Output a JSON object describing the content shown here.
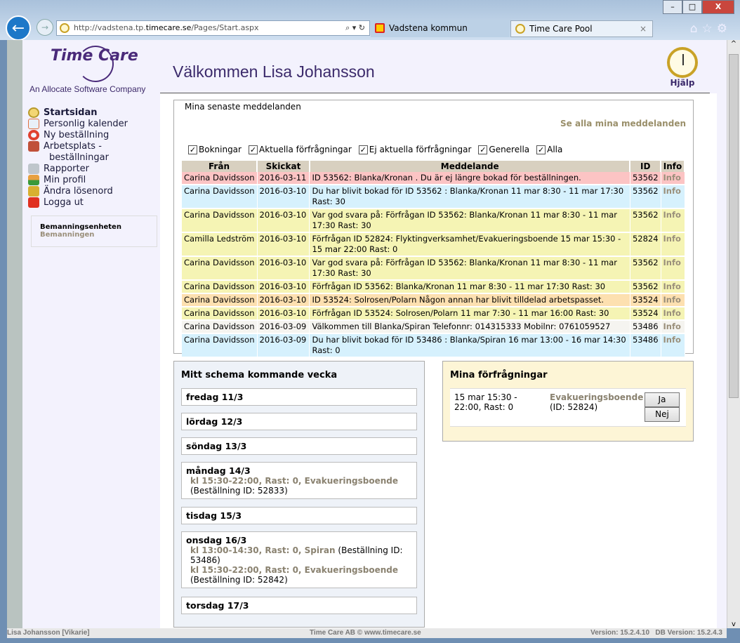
{
  "browser": {
    "url_prefix": "http://vadstena.tp.",
    "url_domain": "timecare.se",
    "url_path": "/Pages/Start.aspx",
    "tabs": [
      {
        "label": "Vadstena kommun"
      },
      {
        "label": "Time Care Pool"
      }
    ],
    "close": "×"
  },
  "header": {
    "logo": "Time Care",
    "tagline": "An Allocate Software Company",
    "welcome": "Välkommen Lisa Johansson",
    "help": "Hjälp"
  },
  "nav": {
    "items": [
      {
        "label": "Startsidan",
        "icon": "clock-icon"
      },
      {
        "label": "Personlig kalender",
        "icon": "calendar-icon"
      },
      {
        "label": "Ny beställning",
        "icon": "lifebuoy-icon"
      },
      {
        "label": "Arbetsplats -",
        "label2": "beställningar",
        "icon": "workplace-icon"
      },
      {
        "label": "Rapporter",
        "icon": "printer-icon"
      },
      {
        "label": "Min profil",
        "icon": "user-icon"
      },
      {
        "label": "Ändra lösenord",
        "icon": "lock-icon"
      },
      {
        "label": "Logga ut",
        "icon": "power-icon"
      }
    ],
    "unit": {
      "title": "Bemanningsenheten",
      "sub": "Bemanningen"
    }
  },
  "messages": {
    "title": "Mina senaste meddelanden",
    "see_all": "Se alla mina meddelanden",
    "filters": [
      "Bokningar",
      "Aktuella förfrågningar",
      "Ej aktuella förfrågningar",
      "Generella",
      "Alla"
    ],
    "columns": [
      "Från",
      "Skickat",
      "Meddelande",
      "ID",
      "Info"
    ],
    "rows": [
      {
        "from": "Carina Davidsson",
        "sent": "2016-03-11",
        "msg": "ID 53562: Blanka/Kronan . Du är ej längre bokad för beställningen.",
        "id": "53562",
        "info": "Info",
        "color": "#fcc4c4"
      },
      {
        "from": "Carina Davidsson",
        "sent": "2016-03-10",
        "msg": "Du har blivit bokad för ID 53562 : Blanka/Kronan 11 mar 8:30 - 11 mar 17:30 Rast: 30",
        "id": "53562",
        "info": "Info",
        "color": "#d6f1fd"
      },
      {
        "from": "Carina Davidsson",
        "sent": "2016-03-10",
        "msg": "Var god svara på: Förfrågan ID 53562: Blanka/Kronan 11 mar 8:30 - 11 mar 17:30 Rast: 30",
        "id": "53562",
        "info": "Info",
        "color": "#f5f4b4"
      },
      {
        "from": "Camilla Ledström",
        "sent": "2016-03-10",
        "msg": "Förfrågan ID 52824: Flyktingverksamhet/Evakueringsboende 15 mar 15:30 - 15 mar 22:00 Rast: 0",
        "id": "52824",
        "info": "Info",
        "color": "#f5f4b4"
      },
      {
        "from": "Carina Davidsson",
        "sent": "2016-03-10",
        "msg": "Var god svara på: Förfrågan ID 53562: Blanka/Kronan 11 mar 8:30 - 11 mar 17:30 Rast: 30",
        "id": "53562",
        "info": "Info",
        "color": "#f5f4b4"
      },
      {
        "from": "Carina Davidsson",
        "sent": "2016-03-10",
        "msg": "Förfrågan ID 53562: Blanka/Kronan 11 mar 8:30 - 11 mar 17:30 Rast: 30",
        "id": "53562",
        "info": "Info",
        "color": "#f5f4b4"
      },
      {
        "from": "Carina Davidsson",
        "sent": "2016-03-10",
        "msg": "ID 53524: Solrosen/Polarn Någon annan har blivit tilldelad arbetspasset.",
        "id": "53524",
        "info": "Info",
        "color": "#fde0b0"
      },
      {
        "from": "Carina Davidsson",
        "sent": "2016-03-10",
        "msg": "Förfrågan ID 53524: Solrosen/Polarn 11 mar 7:30 - 11 mar 16:00 Rast: 30",
        "id": "53524",
        "info": "Info",
        "color": "#f5f4b4"
      },
      {
        "from": "Carina Davidsson",
        "sent": "2016-03-09",
        "msg": "Välkommen till Blanka/Spiran Telefonnr: 014315333 Mobilnr: 0761059527",
        "id": "53486",
        "info": "Info",
        "color": "#f5f4f0"
      },
      {
        "from": "Carina Davidsson",
        "sent": "2016-03-09",
        "msg": "Du har blivit bokad för ID 53486 : Blanka/Spiran 16 mar 13:00 - 16 mar 14:30 Rast: 0",
        "id": "53486",
        "info": "Info",
        "color": "#d6f1fd"
      }
    ]
  },
  "schedule": {
    "title": "Mitt schema kommande vecka",
    "days": [
      {
        "day": "fredag 11/3",
        "entries": []
      },
      {
        "day": "lördag 12/3",
        "entries": []
      },
      {
        "day": "söndag 13/3",
        "entries": []
      },
      {
        "day": "måndag 14/3",
        "entries": [
          {
            "shift": "kl 15:30-22:00, Rast: 0, Evakueringsboende",
            "detail": "(Beställning ID: 52833)"
          }
        ]
      },
      {
        "day": "tisdag 15/3",
        "entries": []
      },
      {
        "day": "onsdag 16/3",
        "entries": [
          {
            "shift": "kl 13:00-14:30, Rast: 0, Spiran",
            "detail": "(Beställning ID: 53486)"
          },
          {
            "shift": "kl 15:30-22:00, Rast: 0, Evakueringsboende",
            "detail": "(Beställning ID: 52842)"
          }
        ]
      },
      {
        "day": "torsdag 17/3",
        "entries": []
      }
    ]
  },
  "requests": {
    "title": "Mina förfrågningar",
    "time": "15 mar 15:30 - 22:00, Rast: 0",
    "place": "Evakueringsboende",
    "id": "(ID: 52824)",
    "yes": "Ja",
    "no": "Nej"
  },
  "status": {
    "user": "Lisa Johansson [Vikarie]",
    "copyright": "Time Care AB © www.timecare.se",
    "version": "Version: 15.2.4.10   DB Version: 15.2.4.3"
  }
}
